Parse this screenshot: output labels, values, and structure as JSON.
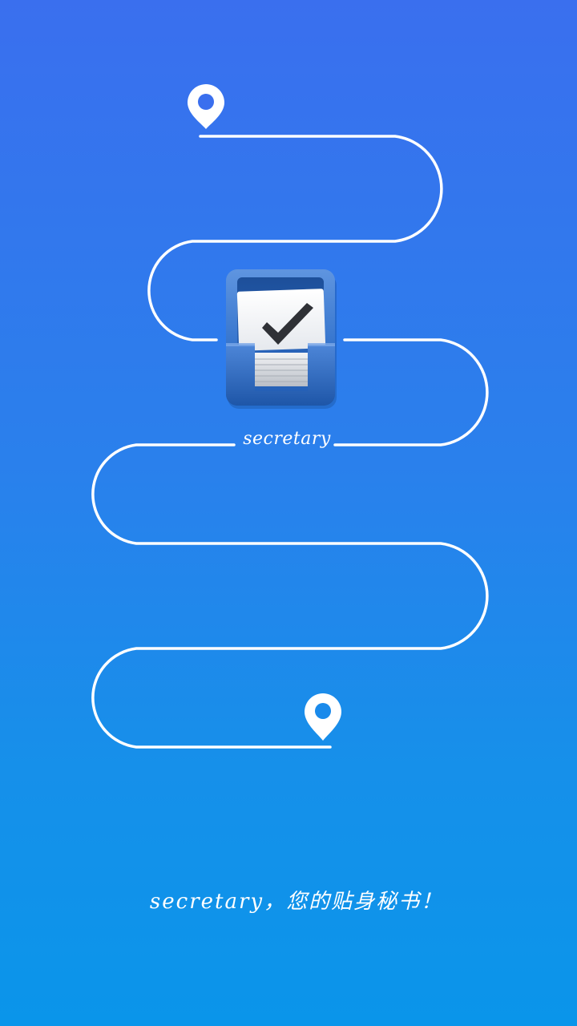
{
  "app": {
    "name_label": "secretary",
    "tagline": "secretary，您的贴身秘书！"
  },
  "colors": {
    "background_top": "#3a6fee",
    "background_bottom": "#0a95ea",
    "route_line": "#ffffff",
    "box_blue": "#2f6fc4"
  },
  "icons": {
    "start_pin": "map-pin-icon",
    "end_pin": "map-pin-icon",
    "app_logo": "checklist-box-icon"
  }
}
